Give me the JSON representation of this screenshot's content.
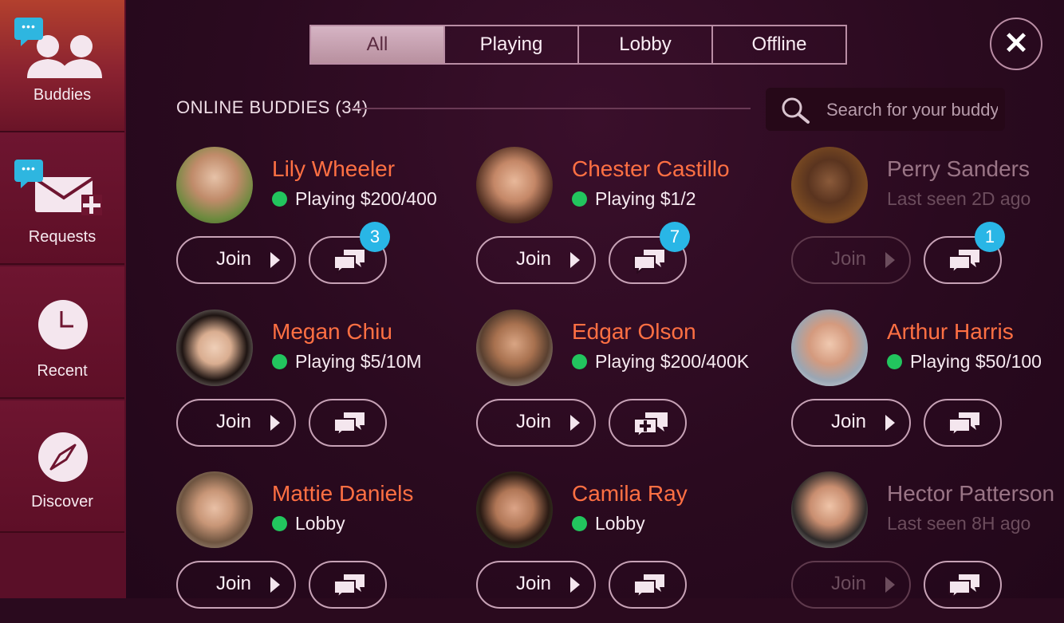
{
  "sidebar": {
    "items": [
      {
        "label": "Buddies",
        "icon": "buddies-icon",
        "active": true,
        "has_bubble": true
      },
      {
        "label": "Requests",
        "icon": "requests-icon",
        "active": false,
        "has_bubble": true
      },
      {
        "label": "Recent",
        "icon": "clock-icon",
        "active": false,
        "has_bubble": false
      },
      {
        "label": "Discover",
        "icon": "compass-icon",
        "active": false,
        "has_bubble": false
      }
    ],
    "bubble_text": "•••"
  },
  "tabs": [
    "All",
    "Playing",
    "Lobby",
    "Offline"
  ],
  "active_tab": "All",
  "close_glyph": "✕",
  "section": {
    "title": "ONLINE BUDDIES (34)"
  },
  "search": {
    "placeholder": "Search for your buddy",
    "value": ""
  },
  "buddy_join_label": "Join",
  "buddies": [
    {
      "name": "Lily Wheeler",
      "status": "Playing $200/400",
      "online": true,
      "chat_badge": "3",
      "chat_icon": "chat-icon"
    },
    {
      "name": "Chester Castillo",
      "status": "Playing $1/2",
      "online": true,
      "chat_badge": "7",
      "chat_icon": "chat-icon"
    },
    {
      "name": "Perry Sanders",
      "status": "Last seen 2D ago",
      "online": false,
      "chat_badge": "1",
      "chat_icon": "chat-icon"
    },
    {
      "name": "Megan Chiu",
      "status": "Playing $5/10M",
      "online": true,
      "chat_badge": "",
      "chat_icon": "chat-icon"
    },
    {
      "name": "Edgar Olson",
      "status": "Playing $200/400K",
      "online": true,
      "chat_badge": "",
      "chat_icon": "chat-add-icon"
    },
    {
      "name": "Arthur Harris",
      "status": "Playing $50/100",
      "online": true,
      "chat_badge": "",
      "chat_icon": "chat-icon"
    },
    {
      "name": "Mattie Daniels",
      "status": "Lobby",
      "online": true,
      "chat_badge": "",
      "chat_icon": "chat-icon"
    },
    {
      "name": "Camila Ray",
      "status": "Lobby",
      "online": true,
      "chat_badge": "",
      "chat_icon": "chat-icon"
    },
    {
      "name": "Hector Patterson",
      "status": "Last seen 8H ago",
      "online": false,
      "chat_badge": "",
      "chat_icon": "chat-icon"
    }
  ],
  "colors": {
    "accent_name": "#ff7043",
    "online_dot": "#22c55e",
    "badge": "#29b6e6",
    "background": "#2a0a1e"
  }
}
